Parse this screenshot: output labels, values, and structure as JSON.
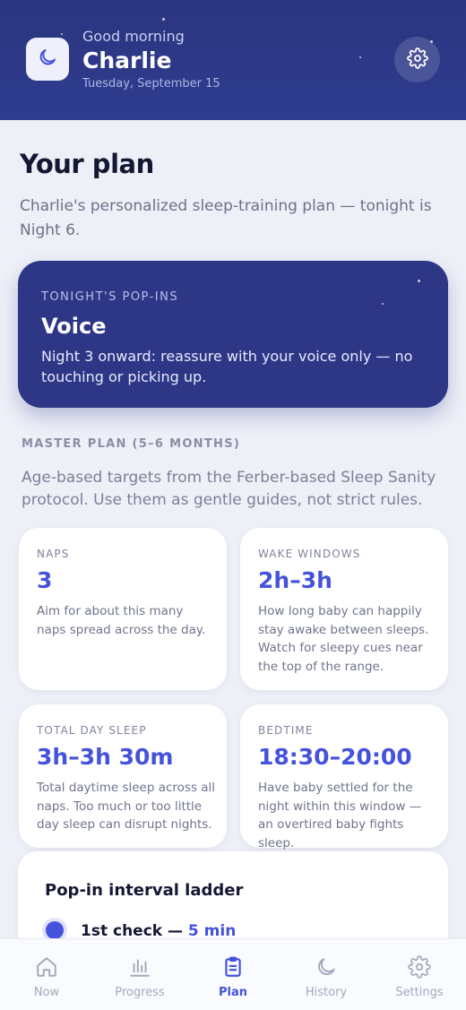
{
  "header": {
    "greeting": "Good morning",
    "name": "Charlie",
    "date": "Tuesday, September 15",
    "badge_icon": "moon-icon",
    "settings_icon": "gear-icon"
  },
  "page": {
    "title": "Your plan",
    "subtitle": "Charlie's personalized sleep-training plan — tonight is Night 6."
  },
  "tonight": {
    "label": "TONIGHT'S POP-INS",
    "title": "Voice",
    "description": "Night 3 onward: reassure with your voice only — no touching or picking up."
  },
  "master_plan": {
    "label": "MASTER PLAN (5–6 MONTHS)",
    "description": "Age-based targets from the Ferber-based Sleep Sanity protocol. Use them as gentle guides, not strict rules.",
    "stats": [
      {
        "label": "NAPS",
        "value": "3",
        "description": "Aim for about this many naps spread across the day."
      },
      {
        "label": "WAKE WINDOWS",
        "value": "2h–3h",
        "description": "How long baby can happily stay awake between sleeps. Watch for sleepy cues near the top of the range."
      },
      {
        "label": "TOTAL DAY SLEEP",
        "value": "3h–3h 30m",
        "description": "Total daytime sleep across all naps. Too much or too little day sleep can disrupt nights."
      },
      {
        "label": "BEDTIME",
        "value": "18:30–20:00",
        "description": "Have baby settled for the night within this window — an overtired baby fights sleep."
      }
    ]
  },
  "ladder": {
    "title": "Pop-in interval ladder",
    "steps": [
      {
        "label": "1st check — ",
        "value": "5 min"
      }
    ]
  },
  "nav": {
    "items": [
      {
        "label": "Now",
        "icon": "home-icon"
      },
      {
        "label": "Progress",
        "icon": "bar-chart-icon"
      },
      {
        "label": "Plan",
        "icon": "clipboard-icon"
      },
      {
        "label": "History",
        "icon": "moon-icon"
      },
      {
        "label": "Settings",
        "icon": "gear-icon"
      }
    ],
    "active": "Plan"
  },
  "colors": {
    "header_bg": "#2b357f",
    "card_bg": "#2e3785",
    "accent": "#4452dc",
    "page_bg": "#eef0f8"
  }
}
